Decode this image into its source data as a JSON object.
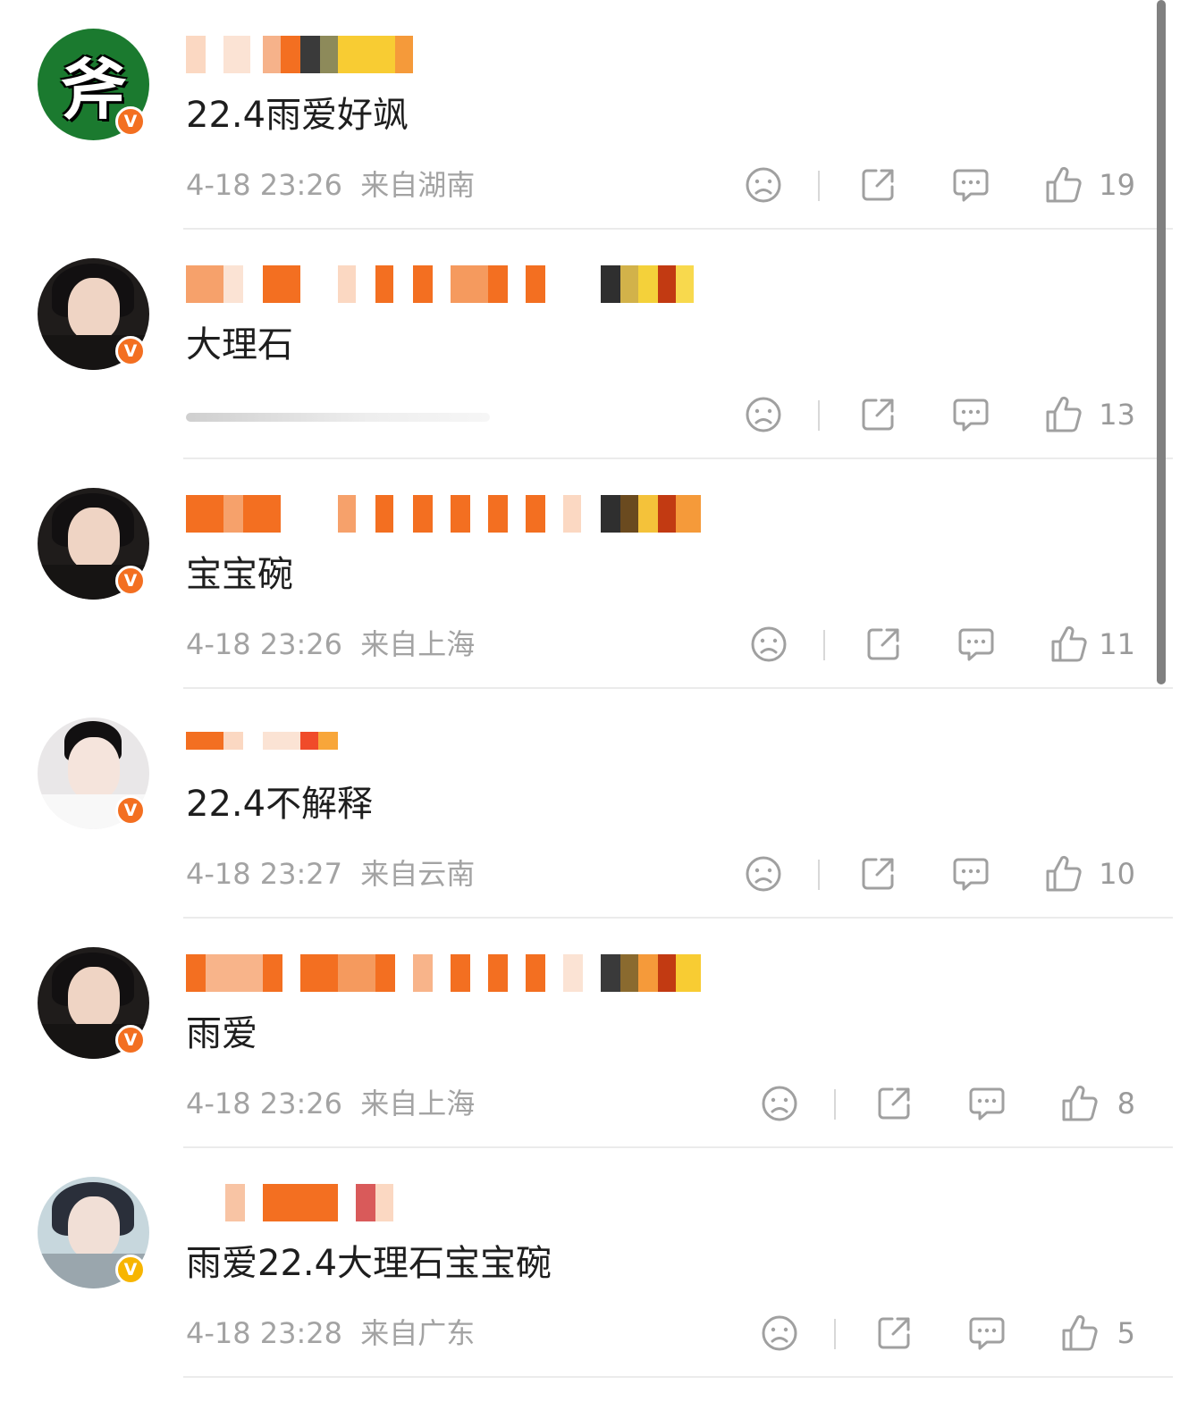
{
  "comments": [
    {
      "content": "22.4雨爱好飒",
      "time": "4-18 23:26",
      "location": "来自湖南",
      "likes": "19",
      "avatar": "avatar-bold-glyph",
      "avatar_glyph": "斧",
      "verified": "V"
    },
    {
      "content": "大理石",
      "time": "",
      "location": "",
      "likes": "13",
      "avatar": "avatar-girl-dark",
      "verified": "V"
    },
    {
      "content": "宝宝碗",
      "time": "4-18 23:26",
      "location": "来自上海",
      "likes": "11",
      "avatar": "avatar-girl-dark",
      "verified": "V"
    },
    {
      "content": "22.4不解释",
      "time": "4-18 23:27",
      "location": "来自云南",
      "likes": "10",
      "avatar": "avatar-girl-light",
      "verified": "V"
    },
    {
      "content": "雨爱",
      "time": "4-18 23:26",
      "location": "来自上海",
      "likes": "8",
      "avatar": "avatar-girl-dark",
      "verified": "V"
    },
    {
      "content": "雨爱22.4大理石宝宝碗",
      "time": "4-18 23:28",
      "location": "来自广东",
      "likes": "5",
      "avatar": "avatar-boy",
      "verified": "V"
    }
  ],
  "colors": {
    "username_orange": "#f36f21",
    "verified_orange": "#f36f21",
    "verified_gold": "#f7b500",
    "meta_gray": "#a3a3a3",
    "text_dark": "#1e1e1e",
    "icon_gray": "#a0a0a0"
  },
  "icons": {
    "dislike": "sad-face-icon",
    "share": "share-icon",
    "reply": "comment-bubble-icon",
    "like": "thumbs-up-icon"
  }
}
